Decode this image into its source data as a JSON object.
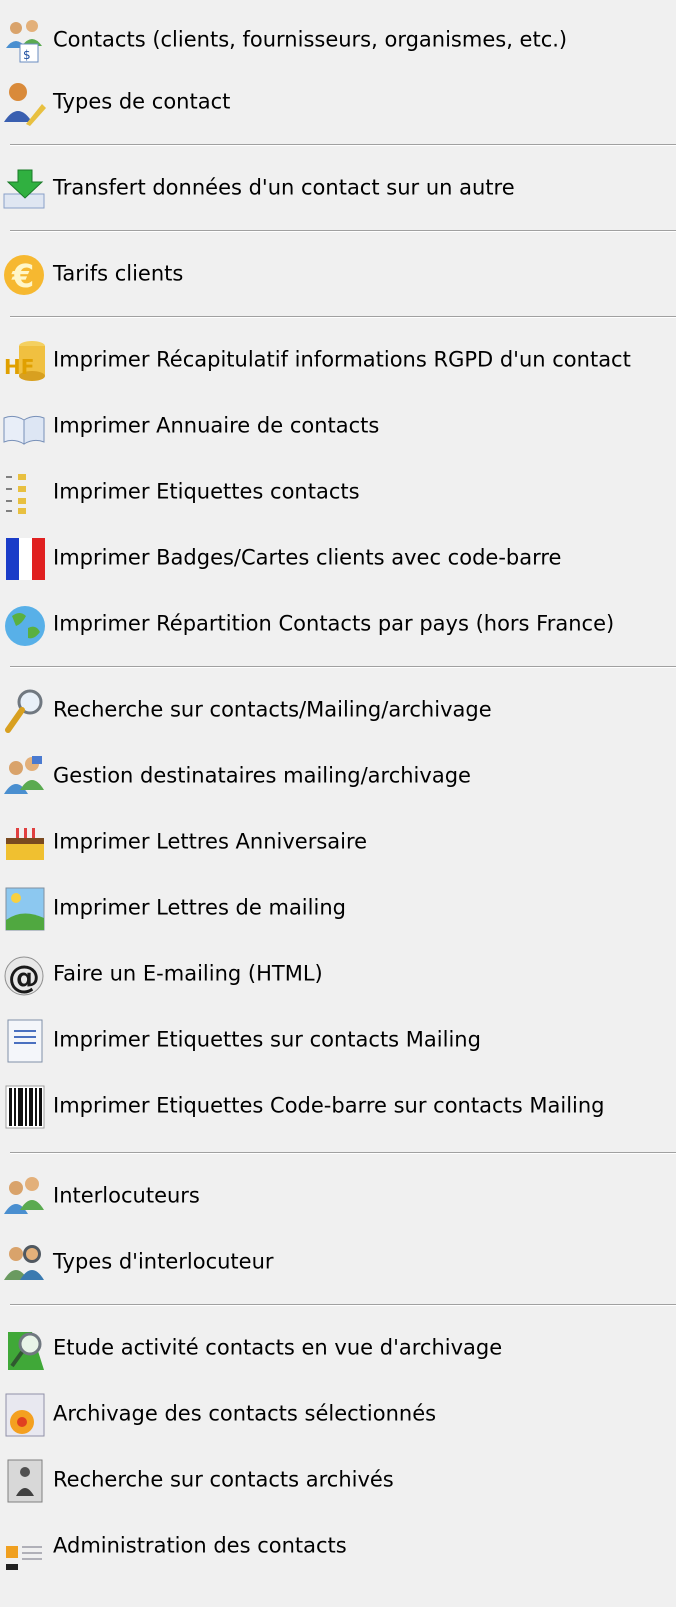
{
  "menu": {
    "items": [
      {
        "label": "Contacts (clients, fournisseurs, organismes, etc.)",
        "icon": "contacts-people-icon"
      },
      {
        "label": "Types de contact",
        "icon": "contact-type-person-pen-icon"
      },
      {
        "label": "Transfert données d'un contact sur un autre",
        "icon": "transfer-green-arrow-icon"
      },
      {
        "label": "Tarifs clients",
        "icon": "euro-icon"
      },
      {
        "label": "Imprimer Récapitulatif informations RGPD d'un contact",
        "icon": "hf-database-icon"
      },
      {
        "label": "Imprimer Annuaire de contacts",
        "icon": "open-book-icon"
      },
      {
        "label": "Imprimer Etiquettes contacts",
        "icon": "labels-list-icon"
      },
      {
        "label": "Imprimer Badges/Cartes clients avec code-barre",
        "icon": "french-flag-icon"
      },
      {
        "label": "Imprimer Répartition Contacts par pays (hors France)",
        "icon": "globe-icon"
      },
      {
        "label": "Recherche sur contacts/Mailing/archivage",
        "icon": "magnifier-icon"
      },
      {
        "label": "Gestion destinataires mailing/archivage",
        "icon": "recipients-people-icon"
      },
      {
        "label": "Imprimer Lettres Anniversaire",
        "icon": "birthday-cake-icon"
      },
      {
        "label": "Imprimer Lettres de mailing",
        "icon": "landscape-letter-icon"
      },
      {
        "label": "Faire un E-mailing (HTML)",
        "icon": "at-sign-icon"
      },
      {
        "label": "Imprimer Etiquettes sur contacts Mailing",
        "icon": "document-lines-icon"
      },
      {
        "label": "Imprimer Etiquettes Code-barre sur contacts Mailing",
        "icon": "barcode-icon"
      },
      {
        "label": "Interlocuteurs",
        "icon": "interlocutors-people-icon"
      },
      {
        "label": "Types d'interlocuteur",
        "icon": "interlocutor-type-people-icon"
      },
      {
        "label": "Etude activité contacts en vue d'archivage",
        "icon": "activity-study-icon"
      },
      {
        "label": "Archivage des contacts sélectionnés",
        "icon": "archive-disc-icon"
      },
      {
        "label": "Recherche sur contacts archivés",
        "icon": "archived-search-icon"
      },
      {
        "label": "Administration des contacts",
        "icon": "administration-icon"
      }
    ]
  }
}
